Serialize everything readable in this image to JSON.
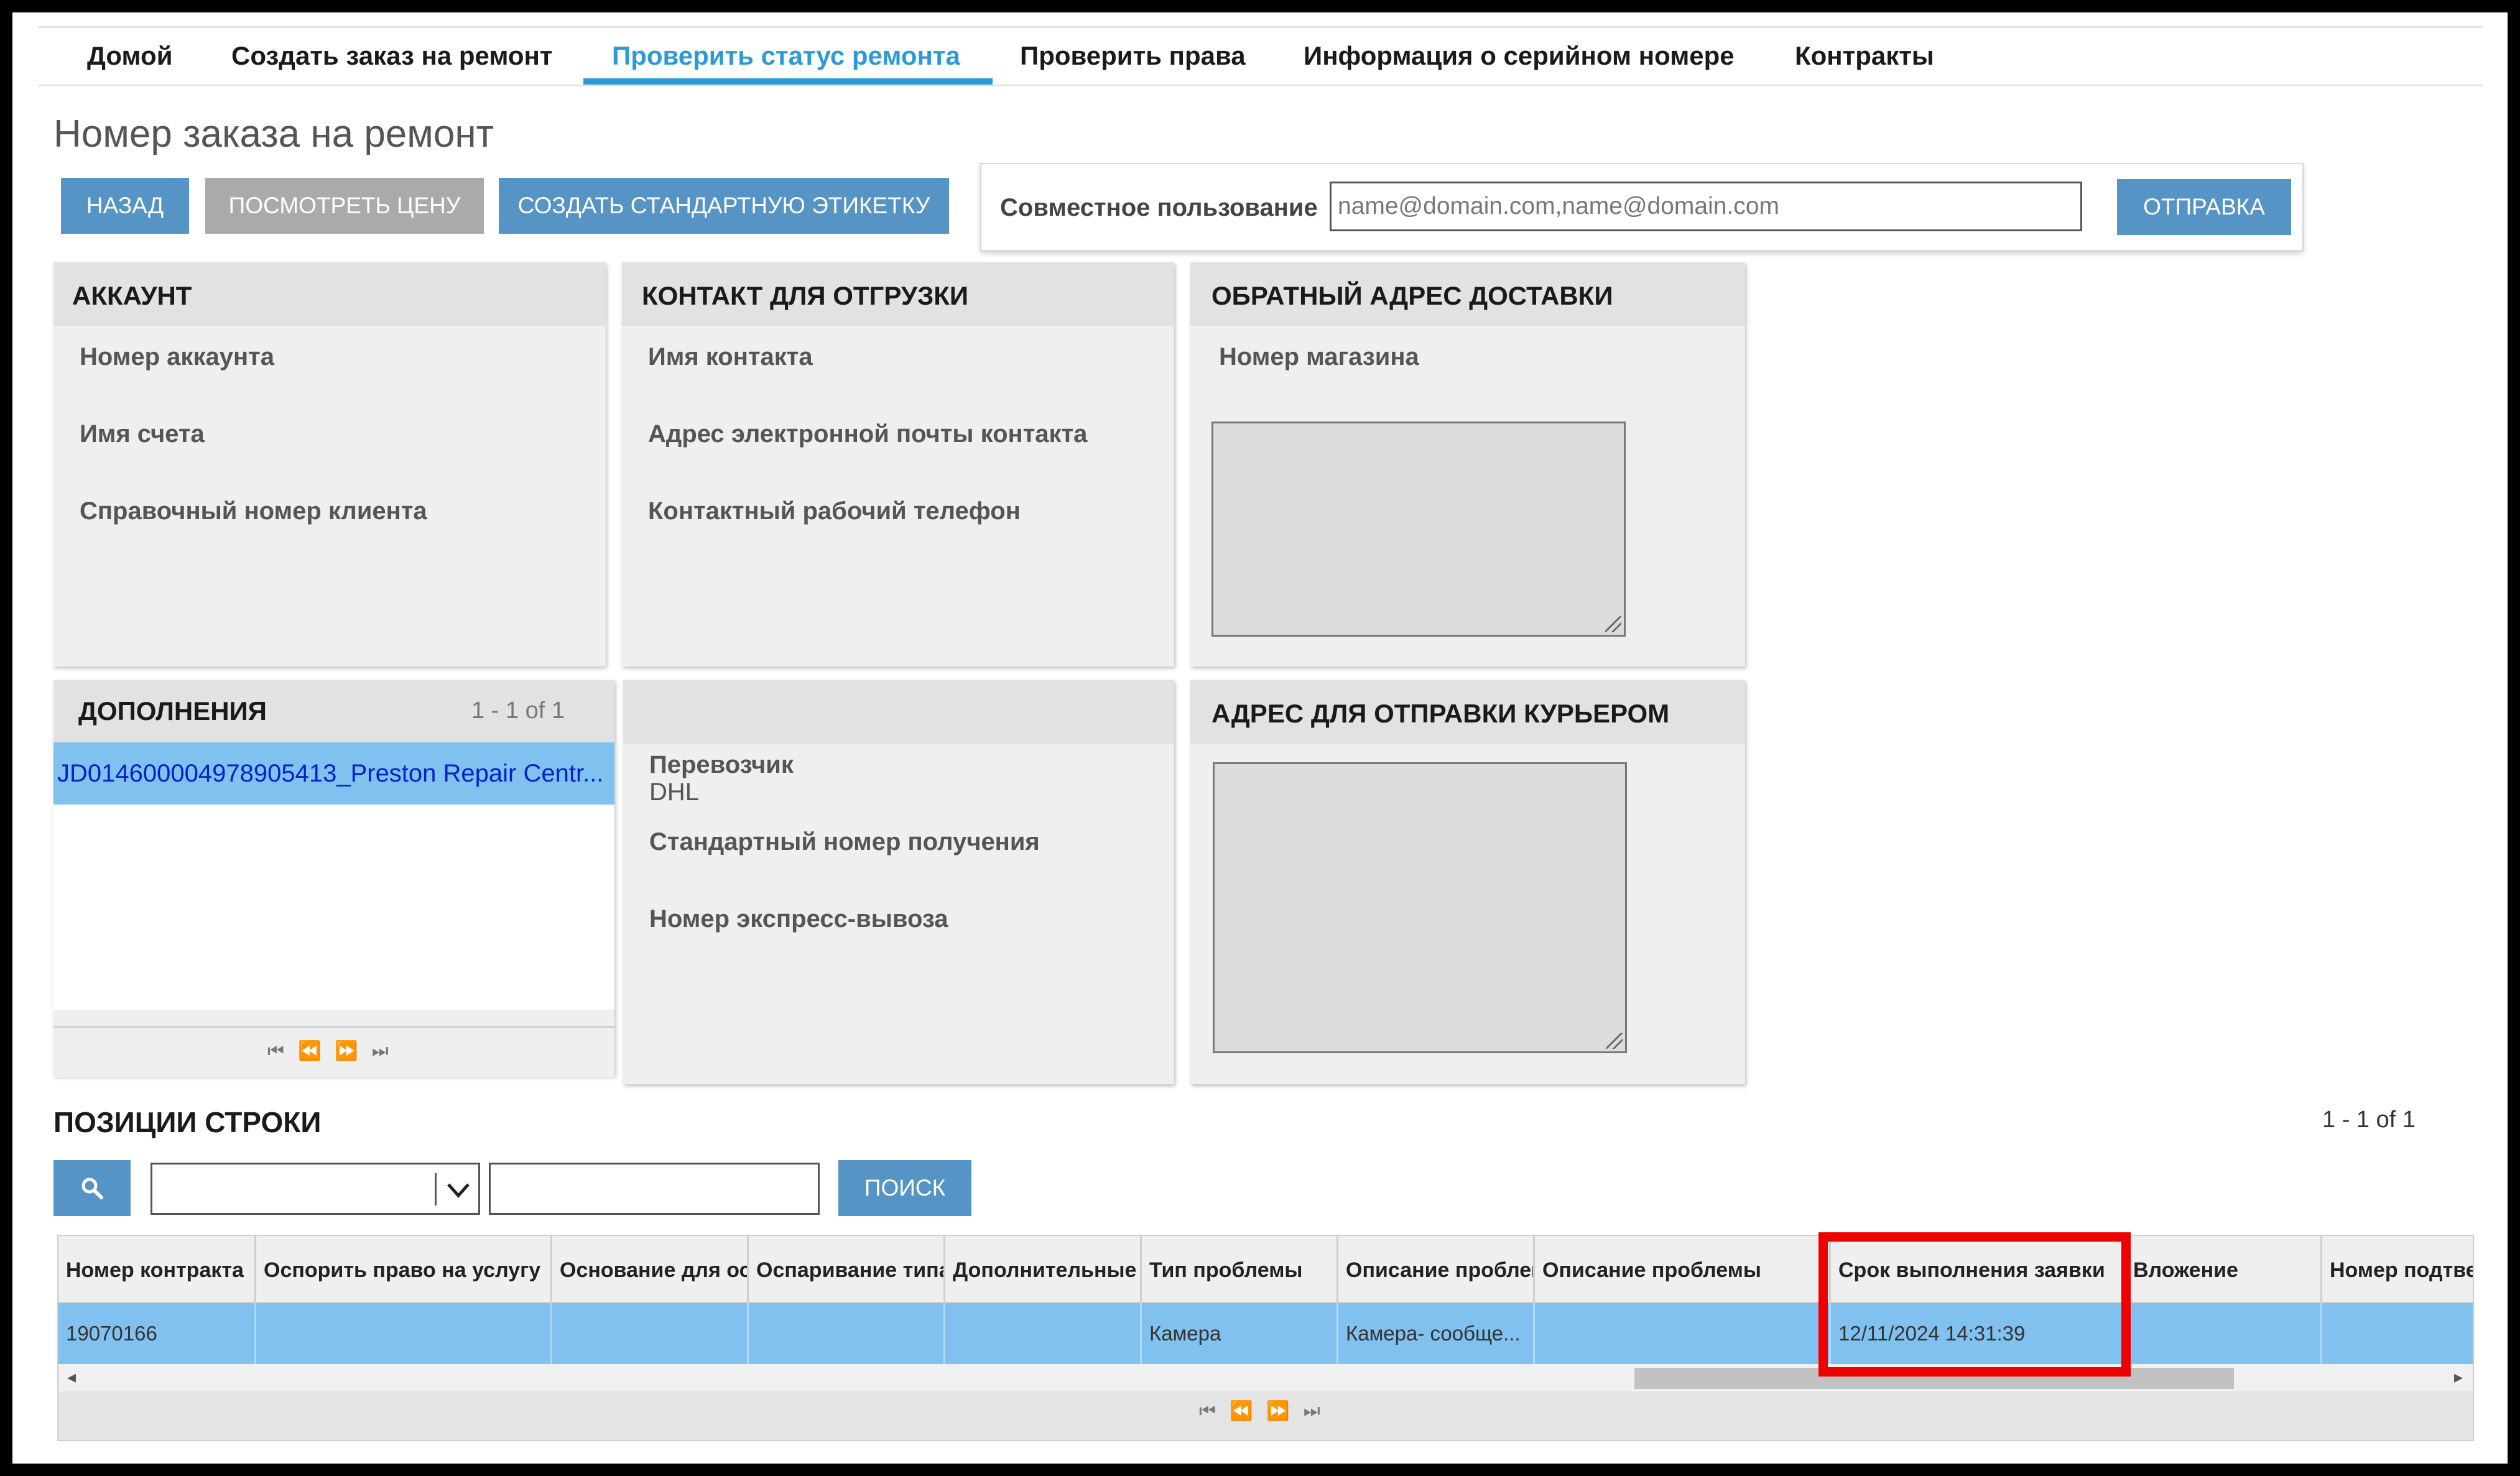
{
  "nav": {
    "items": [
      {
        "label": "Домой"
      },
      {
        "label": "Создать заказ на ремонт"
      },
      {
        "label": "Проверить статус ремонта",
        "active": true
      },
      {
        "label": "Проверить права"
      },
      {
        "label": "Информация о серийном номере"
      },
      {
        "label": "Контракты"
      }
    ],
    "accent_color": "#2c9ad6"
  },
  "page": {
    "title": "Номер заказа на ремонт"
  },
  "toolbar": {
    "back_label": "Назад",
    "view_price_label": "Посмотреть цену",
    "create_label_label": "Создать стандартную этикетку",
    "button_color": "#5594c5",
    "disabled_color": "#aaaaaa"
  },
  "share": {
    "label": "Совместное пользование",
    "placeholder": "name@domain.com,name@domain.com",
    "submit_label": "Отправка"
  },
  "account": {
    "title": "АККАУНТ",
    "fields": [
      "Номер аккаунта",
      "Имя счета",
      "Справочный номер клиента"
    ]
  },
  "shipping_contact": {
    "title": "КОНТАКТ ДЛЯ ОТГРУЗКИ",
    "fields": [
      "Имя контакта",
      "Адрес электронной почты контакта",
      "Контактный рабочий телефон"
    ]
  },
  "return_address": {
    "title": "ОБРАТНЫЙ АДРЕС ДОСТАВКИ",
    "field": "Номер магазина"
  },
  "attachments": {
    "title": "ДОПОЛНЕНИЯ",
    "count": "1 - 1 of 1",
    "items": [
      "JD014600004978905413_Preston Repair Centr..."
    ]
  },
  "carrier": {
    "carrier_label": "Перевозчик",
    "carrier_value": "DHL",
    "standard_tracking_label": "Стандартный номер получения",
    "express_pickup_label": "Номер экспресс-вывоза"
  },
  "courier_address": {
    "title": "АДРЕС ДЛЯ ОТПРАВКИ КУРЬЕРОМ"
  },
  "line_items": {
    "title": "ПОЗИЦИИ СТРОКИ",
    "count": "1 - 1 of 1",
    "search_label": "Поиск",
    "columns": [
      "Номер контракта",
      "Оспорить право на услугу",
      "Основание для оспаривания",
      "Оспаривание типа",
      "Дополнительные сведения",
      "Тип проблемы",
      "Описание проблемы",
      "Описание проблемы",
      "Срок выполнения заявки",
      "Вложение",
      "Номер подтверждения"
    ],
    "rows": [
      [
        "19070166",
        "",
        "",
        "",
        "",
        "Камера",
        "Камера- сообще...",
        "",
        "12/11/2024 14:31:39",
        "",
        ""
      ]
    ],
    "highlight_color": "#ee0000"
  }
}
